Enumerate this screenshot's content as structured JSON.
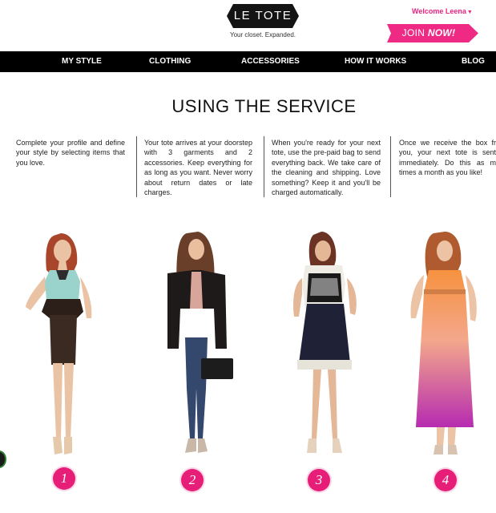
{
  "header": {
    "logo_text": "LE TOTE",
    "tagline": "Your closet. Expanded.",
    "welcome": "Welcome Leena",
    "join_prefix": "JOIN",
    "join_suffix": "NOW!",
    "brand_pink": "#e8237f"
  },
  "nav": {
    "items": [
      "MY STYLE",
      "CLOTHING",
      "ACCESSORIES",
      "HOW IT WORKS",
      "BLOG"
    ]
  },
  "main": {
    "title": "USING THE SERVICE",
    "steps": [
      {
        "text": "Complete your profile and define your style by selecting items that you love.",
        "number": "1"
      },
      {
        "text": "Your tote arrives at your doorstep with 3 garments and 2 accessories. Keep everything for as long as you want. Never worry about return dates or late charges.",
        "number": "2"
      },
      {
        "text": "When you're ready for your next tote, use the pre-paid bag to send everything back. We take care of the cleaning and shipping. Love something? Keep it and you'll be charged automatically.",
        "number": "3"
      },
      {
        "text": "Once we receive the box fr you, your next tote is sent immediately. Do this as m times a month as you like!",
        "number": "4"
      }
    ]
  }
}
